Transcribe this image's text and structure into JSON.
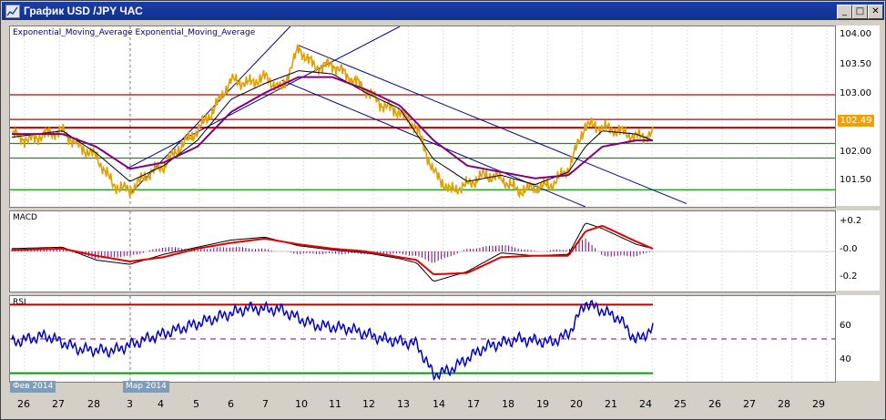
{
  "window": {
    "title": "График USD /JPY ЧАС",
    "buttons": [
      "_",
      "□",
      "✕"
    ]
  },
  "main_panel": {
    "label": "Exponential_Moving_Average Exponential_Moving_Average",
    "y_ticks": [
      "104.00",
      "103.50",
      "103.00",
      "102.00",
      "101.50"
    ],
    "current_price": "102.49"
  },
  "macd_panel": {
    "label": "MACD",
    "y_ticks": [
      "+0.2",
      "-0.0",
      "-0.2"
    ]
  },
  "rsi_panel": {
    "label": "RSI",
    "y_ticks": [
      "60",
      "40"
    ]
  },
  "x_axis": {
    "labels": [
      "26",
      "27",
      "28",
      "3",
      "4",
      "5",
      "6",
      "7",
      "10",
      "11",
      "12",
      "13",
      "14",
      "17",
      "18",
      "19",
      "20",
      "21",
      "24",
      "25",
      "26",
      "27",
      "28",
      "29"
    ],
    "month_tags": [
      "Фев 2014",
      "Мар 2014"
    ]
  },
  "colors": {
    "title_bar": "#12308e",
    "price": "#e0a000",
    "ema_fast": "#000000",
    "ema_slow": "#800080",
    "channel": "#00008b",
    "resistance": "#c00000",
    "support": "#00a000",
    "macd_signal": "#e00000",
    "rsi_line": "#0000c0"
  },
  "chart_data": [
    {
      "type": "line",
      "name": "USD/JPY hourly",
      "ylim": [
        101.25,
        104.1
      ],
      "current": 102.49,
      "price_path": [
        [
          0,
          102.4
        ],
        [
          1,
          102.3
        ],
        [
          2,
          102.4
        ],
        [
          3,
          102.45
        ],
        [
          4,
          102.2
        ],
        [
          5,
          102.05
        ],
        [
          6,
          101.6
        ],
        [
          7,
          101.5
        ],
        [
          8,
          101.75
        ],
        [
          9,
          101.9
        ],
        [
          10,
          102.2
        ],
        [
          11,
          102.45
        ],
        [
          12,
          102.8
        ],
        [
          13,
          103.25
        ],
        [
          14,
          103.2
        ],
        [
          15,
          103.3
        ],
        [
          16,
          103.1
        ],
        [
          17,
          103.75
        ],
        [
          18,
          103.45
        ],
        [
          19,
          103.5
        ],
        [
          20,
          103.3
        ],
        [
          21,
          103.1
        ],
        [
          22,
          102.85
        ],
        [
          23,
          102.75
        ],
        [
          24,
          102.5
        ],
        [
          25,
          101.8
        ],
        [
          26,
          101.5
        ],
        [
          27,
          101.6
        ],
        [
          28,
          101.75
        ],
        [
          29,
          101.7
        ],
        [
          30,
          101.5
        ],
        [
          31,
          101.55
        ],
        [
          32,
          101.6
        ],
        [
          33,
          101.85
        ],
        [
          34,
          102.55
        ],
        [
          35,
          102.5
        ],
        [
          36,
          102.45
        ],
        [
          37,
          102.35
        ],
        [
          38,
          102.4
        ]
      ],
      "ema_fast": [
        [
          0,
          102.35
        ],
        [
          3,
          102.45
        ],
        [
          5,
          102.1
        ],
        [
          7,
          101.65
        ],
        [
          9,
          101.9
        ],
        [
          11,
          102.3
        ],
        [
          13,
          102.95
        ],
        [
          15,
          103.2
        ],
        [
          17,
          103.4
        ],
        [
          19,
          103.35
        ],
        [
          21,
          103.05
        ],
        [
          23,
          102.8
        ],
        [
          25,
          102.0
        ],
        [
          27,
          101.65
        ],
        [
          29,
          101.75
        ],
        [
          31,
          101.6
        ],
        [
          33,
          101.8
        ],
        [
          34,
          102.2
        ],
        [
          35,
          102.45
        ],
        [
          37,
          102.4
        ],
        [
          38,
          102.3
        ]
      ],
      "ema_slow": [
        [
          0,
          102.4
        ],
        [
          3,
          102.4
        ],
        [
          5,
          102.2
        ],
        [
          7,
          101.85
        ],
        [
          9,
          101.95
        ],
        [
          11,
          102.2
        ],
        [
          13,
          102.75
        ],
        [
          15,
          103.05
        ],
        [
          17,
          103.3
        ],
        [
          19,
          103.3
        ],
        [
          21,
          103.1
        ],
        [
          23,
          102.85
        ],
        [
          25,
          102.3
        ],
        [
          27,
          101.9
        ],
        [
          29,
          101.8
        ],
        [
          31,
          101.7
        ],
        [
          33,
          101.75
        ],
        [
          35,
          102.2
        ],
        [
          37,
          102.3
        ],
        [
          38,
          102.3
        ]
      ],
      "resistance_levels": [
        103.02,
        102.63,
        102.5
      ],
      "support_levels": [
        102.25,
        102.02,
        101.52
      ]
    },
    {
      "type": "line",
      "name": "MACD",
      "ylim": [
        -0.28,
        0.28
      ],
      "macd": [
        [
          0,
          0.02
        ],
        [
          3,
          0.03
        ],
        [
          5,
          -0.06
        ],
        [
          7,
          -0.09
        ],
        [
          9,
          -0.02
        ],
        [
          11,
          0.03
        ],
        [
          13,
          0.08
        ],
        [
          15,
          0.1
        ],
        [
          17,
          0.04
        ],
        [
          19,
          0.01
        ],
        [
          21,
          -0.01
        ],
        [
          23,
          -0.05
        ],
        [
          24,
          -0.08
        ],
        [
          25,
          -0.21
        ],
        [
          27,
          -0.14
        ],
        [
          29,
          -0.01
        ],
        [
          31,
          -0.03
        ],
        [
          33,
          -0.02
        ],
        [
          34,
          0.2
        ],
        [
          35,
          0.16
        ],
        [
          37,
          0.05
        ],
        [
          38,
          0.02
        ]
      ],
      "signal": [
        [
          0,
          0.01
        ],
        [
          3,
          0.02
        ],
        [
          5,
          -0.03
        ],
        [
          7,
          -0.07
        ],
        [
          9,
          -0.04
        ],
        [
          11,
          0.02
        ],
        [
          13,
          0.06
        ],
        [
          15,
          0.09
        ],
        [
          17,
          0.05
        ],
        [
          19,
          0.02
        ],
        [
          21,
          0.0
        ],
        [
          23,
          -0.04
        ],
        [
          24,
          -0.06
        ],
        [
          25,
          -0.16
        ],
        [
          27,
          -0.15
        ],
        [
          29,
          -0.04
        ],
        [
          31,
          -0.03
        ],
        [
          33,
          -0.03
        ],
        [
          34,
          0.14
        ],
        [
          35,
          0.18
        ],
        [
          37,
          0.07
        ],
        [
          38,
          0.02
        ]
      ]
    },
    {
      "type": "line",
      "name": "RSI",
      "ylim": [
        25,
        75
      ],
      "levels": [
        70,
        50,
        30
      ],
      "values": [
        [
          0,
          48
        ],
        [
          2,
          52
        ],
        [
          4,
          44
        ],
        [
          6,
          43
        ],
        [
          8,
          50
        ],
        [
          10,
          56
        ],
        [
          12,
          62
        ],
        [
          14,
          68
        ],
        [
          16,
          67
        ],
        [
          17,
          62
        ],
        [
          18,
          58
        ],
        [
          20,
          56
        ],
        [
          22,
          50
        ],
        [
          24,
          47
        ],
        [
          25,
          29
        ],
        [
          26,
          32
        ],
        [
          28,
          45
        ],
        [
          30,
          50
        ],
        [
          32,
          48
        ],
        [
          33,
          53
        ],
        [
          34,
          71
        ],
        [
          36,
          62
        ],
        [
          37,
          49
        ],
        [
          38,
          56
        ]
      ]
    }
  ]
}
